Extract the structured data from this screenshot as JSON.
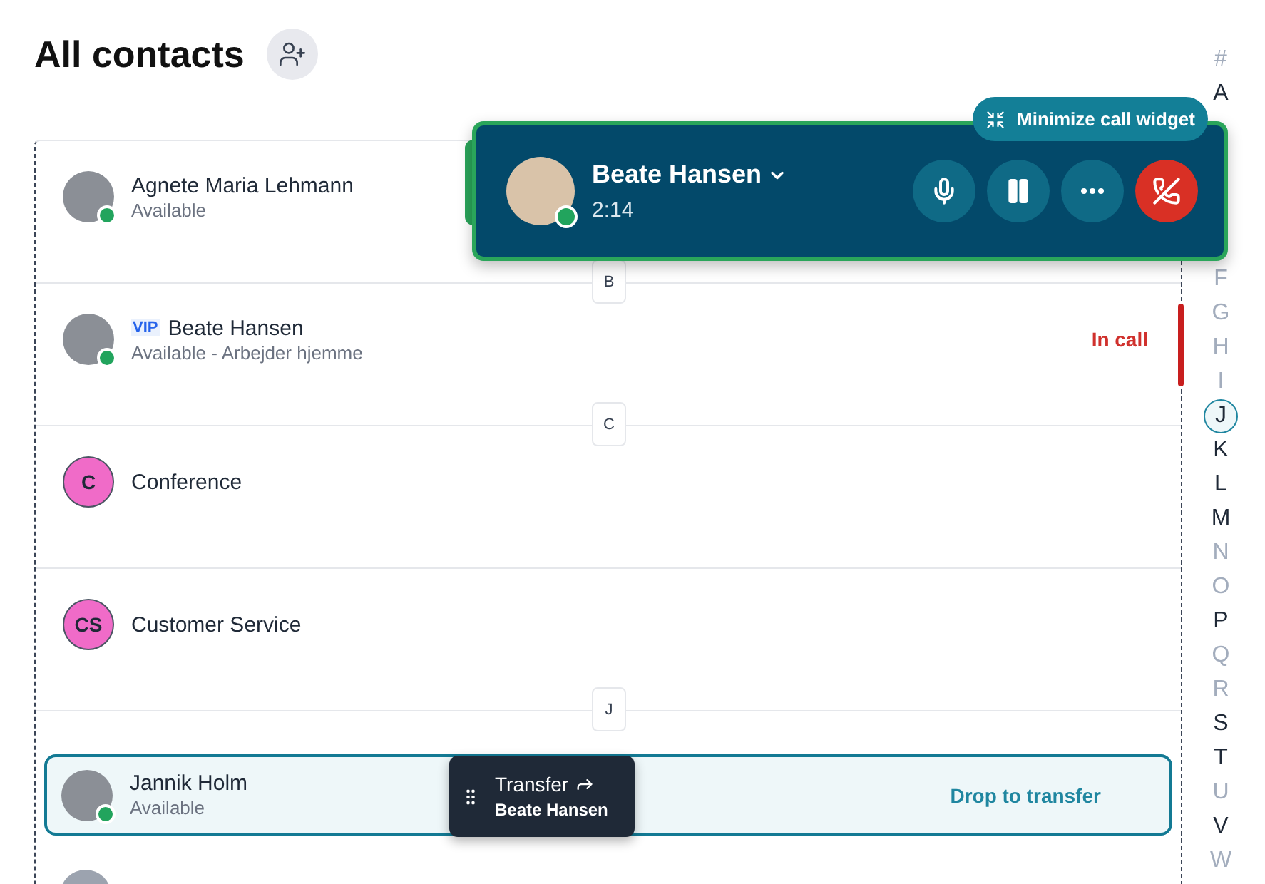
{
  "title": "All contacts",
  "contacts": [
    {
      "kind": "contact",
      "name": "Agnete Maria Lehmann",
      "status": "Available",
      "online": true,
      "vip": false,
      "drop_target": false
    },
    {
      "kind": "letter",
      "letter": "B"
    },
    {
      "kind": "contact",
      "name": "Beate Hansen",
      "status": "Available - Arbejder hjemme",
      "online": true,
      "vip": true,
      "vip_label": "VIP",
      "call_state": "In call",
      "drop_target": false
    },
    {
      "kind": "letter",
      "letter": "C"
    },
    {
      "kind": "contact",
      "name": "Conference",
      "initials": "C",
      "color": "#f06bc8",
      "vip": false,
      "drop_target": false
    },
    {
      "kind": "divider"
    },
    {
      "kind": "contact",
      "name": "Customer Service",
      "initials": "CS",
      "color": "#f06bc8",
      "vip": false,
      "drop_target": false
    },
    {
      "kind": "letter",
      "letter": "J"
    },
    {
      "kind": "contact",
      "name": "Jannik Holm",
      "status": "Available",
      "online": true,
      "vip": false,
      "drop_target": true,
      "drop_label": "Drop to transfer"
    },
    {
      "kind": "partial"
    }
  ],
  "alphabet_index": {
    "above_widget": [
      {
        "letter": "#",
        "disabled": true,
        "selected": false
      },
      {
        "letter": "A",
        "disabled": false,
        "selected": false
      }
    ],
    "below_widget": [
      {
        "letter": "F",
        "disabled": true,
        "selected": false
      },
      {
        "letter": "G",
        "disabled": true,
        "selected": false
      },
      {
        "letter": "H",
        "disabled": true,
        "selected": false
      },
      {
        "letter": "I",
        "disabled": true,
        "selected": false
      },
      {
        "letter": "J",
        "disabled": false,
        "selected": true
      },
      {
        "letter": "K",
        "disabled": false,
        "selected": false
      },
      {
        "letter": "L",
        "disabled": false,
        "selected": false
      },
      {
        "letter": "M",
        "disabled": false,
        "selected": false
      },
      {
        "letter": "N",
        "disabled": true,
        "selected": false
      },
      {
        "letter": "O",
        "disabled": true,
        "selected": false
      },
      {
        "letter": "P",
        "disabled": false,
        "selected": false
      },
      {
        "letter": "Q",
        "disabled": true,
        "selected": false
      },
      {
        "letter": "R",
        "disabled": true,
        "selected": false
      },
      {
        "letter": "S",
        "disabled": false,
        "selected": false
      },
      {
        "letter": "T",
        "disabled": false,
        "selected": false
      },
      {
        "letter": "U",
        "disabled": true,
        "selected": false
      },
      {
        "letter": "V",
        "disabled": false,
        "selected": false
      },
      {
        "letter": "W",
        "disabled": true,
        "selected": false
      }
    ]
  },
  "call_widget": {
    "minimize_label": "Minimize call widget",
    "name": "Beate Hansen",
    "duration": "2:14",
    "online": true,
    "buttons": [
      {
        "kind": "mute"
      },
      {
        "kind": "hold"
      },
      {
        "kind": "more"
      },
      {
        "kind": "hangup"
      }
    ]
  },
  "transfer_chip": {
    "label": "Transfer",
    "name": "Beate Hansen"
  }
}
